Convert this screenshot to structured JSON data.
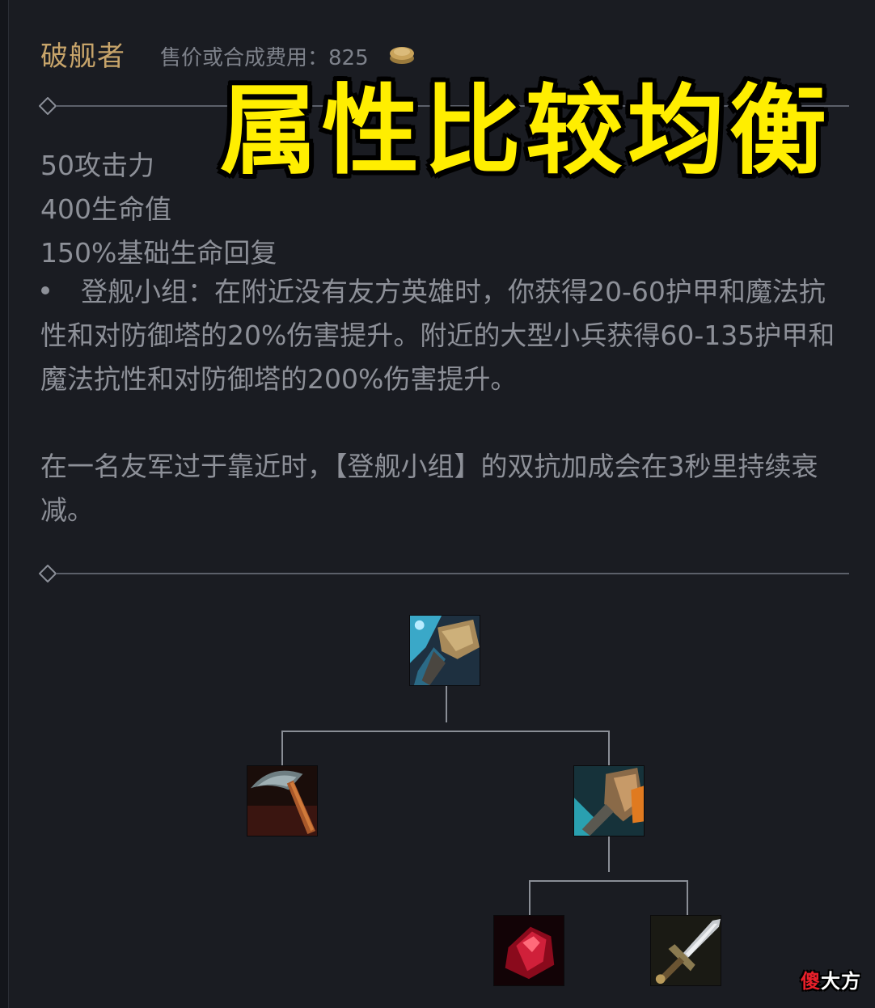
{
  "item": {
    "name": "破舰者",
    "cost_label": "售价或合成费用：",
    "cost_value": "825",
    "coin_icon": "gold-coin-icon"
  },
  "banner": "属性比较均衡",
  "stats": [
    "50攻击力",
    "400生命值",
    "150%基础生命回复"
  ],
  "passive": "登舰小组：在附近没有友方英雄时，你获得20-60护甲和魔法抗性和对防御塔的20%伤害提升。附近的大型小兵获得60-135护甲和魔法抗性和对防御塔的200%伤害提升。",
  "note": "在一名友军过于靠近时，【登舰小组】的双抗加成会在3秒里持续衰减。",
  "recipe_tree": {
    "root": "hullbreaker-icon",
    "children": [
      {
        "icon": "pickaxe-icon"
      },
      {
        "icon": "jaurim-fist-icon",
        "children": [
          {
            "icon": "ruby-crystal-icon"
          },
          {
            "icon": "long-sword-icon"
          }
        ]
      }
    ]
  },
  "watermark": {
    "first": "傻",
    "rest": "大方"
  },
  "colors": {
    "background": "#1a1c22",
    "title": "#c7a46a",
    "text": "#8d9098",
    "banner": "#ffee00"
  }
}
